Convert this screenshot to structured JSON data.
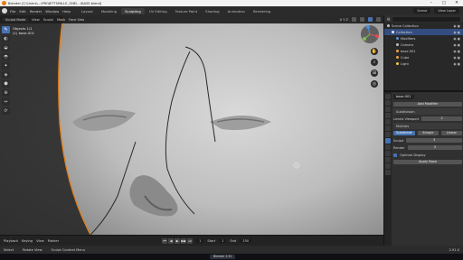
{
  "titlebar": {
    "title": "Blender [C:\\Users\\…\\PROJETTI\\PALLE_ONE\\…\\BASE.blend]",
    "ctrl_min": "–",
    "ctrl_max": "□",
    "ctrl_close": "✕"
  },
  "menubar": {
    "menus": [
      "File",
      "Edit",
      "Render",
      "Window",
      "Help"
    ],
    "tabs": [
      "Layout",
      "Modeling",
      "Sculpting",
      "UV Editing",
      "Texture Paint",
      "Shading",
      "Animation",
      "Rendering"
    ],
    "active_tab": "Sculpting",
    "scene": "Scene",
    "view_layer": "View Layer"
  },
  "viewport": {
    "header": {
      "mode": "Sculpt Mode",
      "view": "View",
      "sculpt": "Sculpt",
      "mask": "Mask",
      "face_sets": "Face Sets",
      "symmetry": "X Y Z"
    },
    "info_line1": "Objects 1/1",
    "info_line2": "(1) base.001"
  },
  "toolbar": {
    "tools": [
      "✎",
      "◐",
      "◒",
      "◓",
      "✦",
      "◈",
      "⬢",
      "⊕",
      "↔",
      "⟳"
    ]
  },
  "nav_buttons": [
    "✋",
    "⌕",
    "⊞",
    "◎"
  ],
  "outliner": {
    "header_icon": "▤",
    "rows": [
      {
        "label": "Scene Collection",
        "indent": 0,
        "color": "#bfbfbf",
        "selected": false
      },
      {
        "label": "Collection",
        "indent": 1,
        "color": "#e6e6e6",
        "selected": true
      },
      {
        "label": "Modifiers",
        "indent": 2,
        "color": "#5a95d6",
        "selected": false
      },
      {
        "label": "Camera",
        "indent": 2,
        "color": "#bfbfbf",
        "selected": false
      },
      {
        "label": "base.001",
        "indent": 2,
        "color": "#f0a442",
        "selected": false
      },
      {
        "label": "Cube",
        "indent": 2,
        "color": "#f0a442",
        "selected": false
      },
      {
        "label": "Light",
        "indent": 2,
        "color": "#f0c94a",
        "selected": false
      }
    ],
    "vis_glyph": "◉ ▣"
  },
  "properties": {
    "object_name": "base.001",
    "add_modifier": "Add Modifier",
    "mod1_name": "Subdivision",
    "mod1_levels_label": "Levels Viewport",
    "mod1_levels_val": "2",
    "mod2_name": "Multires",
    "mod2_levels_label": "Sculpt",
    "mod2_levels_val": "3",
    "btn_subdivide": "Subdivide",
    "btn_simple": "Simple",
    "btn_linear": "Linear",
    "render_label": "Render",
    "render_val": "3",
    "optimal_label": "Optimal Display",
    "shape_label": "Apply Base"
  },
  "timeline": {
    "playback": "Playback",
    "keying": "Keying",
    "view": "View",
    "marker": "Marker",
    "play_glyphs": [
      "⏮",
      "◀",
      "▶",
      "▶▶",
      "⏭"
    ],
    "current_frame": "1",
    "start_label": "Start",
    "start": "1",
    "end_label": "End",
    "end": "250"
  },
  "statusbar": {
    "hint_select": "Select",
    "hint_rotate": "Rotate View",
    "hint_menu": "Sculpt Context Menu",
    "version": "2.91.0"
  },
  "taskbar": {
    "app": "Blender 2.91"
  }
}
